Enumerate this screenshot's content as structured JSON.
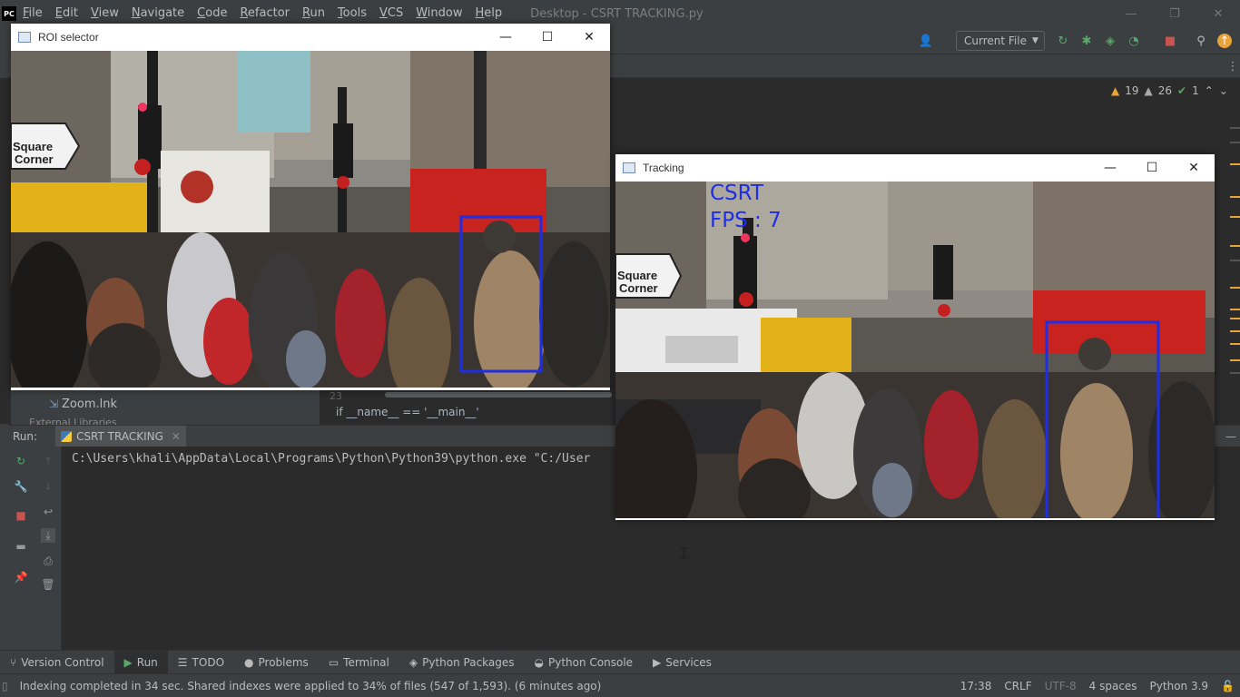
{
  "ide": {
    "logo": "PC",
    "menu": [
      "File",
      "Edit",
      "View",
      "Navigate",
      "Code",
      "Refactor",
      "Run",
      "Tools",
      "VCS",
      "Window",
      "Help"
    ],
    "window_title": "Desktop - CSRT TRACKING.py",
    "run_config": "Current File",
    "inspections": {
      "warnings": "19",
      "weak_warnings": "26",
      "ok": "1"
    },
    "project_tree": {
      "item": "Zoom.lnk",
      "item2": "External Libraries"
    },
    "editor": {
      "line_number": "23",
      "code": "if __name__ == '__main__'"
    },
    "run_panel": {
      "label": "Run:",
      "tab": "CSRT TRACKING",
      "console": "C:\\Users\\khali\\AppData\\Local\\Programs\\Python\\Python39\\python.exe \"C:/User"
    },
    "tool_tabs": [
      "Version Control",
      "Run",
      "TODO",
      "Problems",
      "Terminal",
      "Python Packages",
      "Python Console",
      "Services"
    ],
    "tool_tab_icons": [
      "branch-icon",
      "play-icon",
      "list-icon",
      "problems-icon",
      "terminal-icon",
      "packages-icon",
      "python-console-icon",
      "services-icon"
    ],
    "status": {
      "message": "Indexing completed in 34 sec. Shared indexes were applied to 34% of files (547 of 1,593). (6 minutes ago)",
      "position": "17:38",
      "line_ending": "CRLF",
      "encoding": "UTF-8",
      "indent": "4 spaces",
      "interpreter": "Python 3.9"
    }
  },
  "roi_window": {
    "title": "ROI selector"
  },
  "tracking_window": {
    "title": "Tracking",
    "overlay_line1": "CSRT",
    "overlay_line2": "FPS : 7"
  },
  "scene": {
    "sign_line1": "Square",
    "sign_line2": "Corner",
    "box_color": "#1d2de8"
  }
}
